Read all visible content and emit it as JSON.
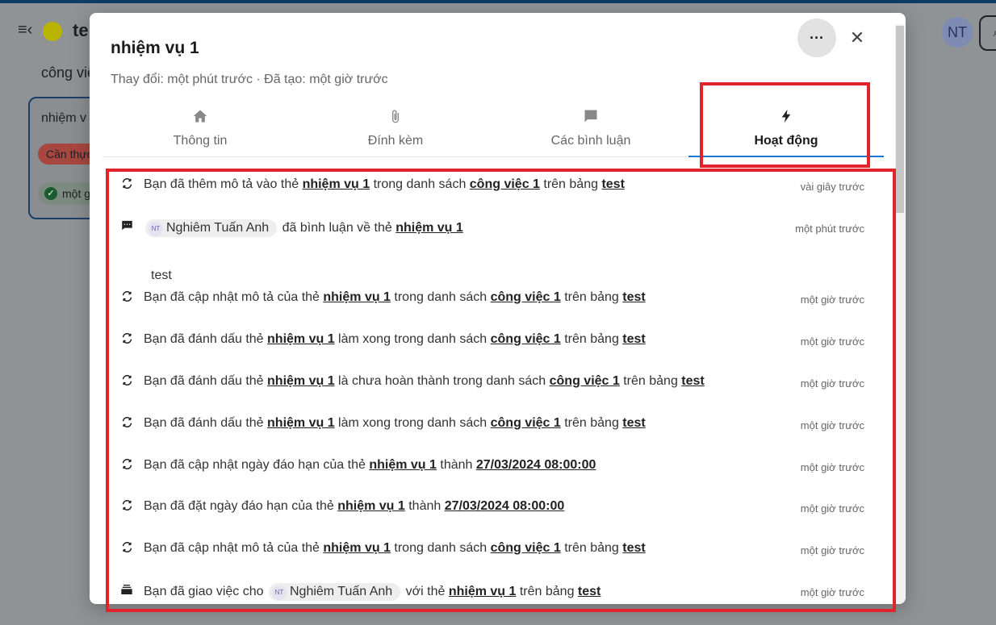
{
  "background": {
    "board_title": "te",
    "avatar_initials": "NT",
    "list_title": "công việ",
    "card_title": "nhiệm v",
    "card_label": "Cần thực",
    "card_due": "một g"
  },
  "modal": {
    "title": "nhiệm vụ 1",
    "subtitle": "Thay đổi: một phút trước · Đã tạo: một giờ trước",
    "more_label": "···",
    "close_label": "✕",
    "tabs": [
      {
        "label": "Thông tin",
        "icon": "home-icon"
      },
      {
        "label": "Đính kèm",
        "icon": "paperclip-icon"
      },
      {
        "label": "Các bình luận",
        "icon": "comment-icon"
      },
      {
        "label": "Hoạt động",
        "icon": "lightning-icon"
      }
    ],
    "activities": [
      {
        "icon": "refresh-icon",
        "time": "vài giây trước",
        "parts": [
          "Bạn đã thêm mô tả vào thẻ ",
          "nhiệm vụ 1",
          " trong danh sách ",
          "công việc 1",
          " trên bảng ",
          "test"
        ]
      },
      {
        "icon": "comment-icon",
        "time": "một phút trước",
        "user_initials": "NT",
        "user": "Nghiêm Tuấn Anh",
        "parts": [
          " đã bình luận về thẻ ",
          "nhiệm vụ 1"
        ],
        "comment": "test"
      },
      {
        "icon": "refresh-icon",
        "time": "một giờ trước",
        "parts": [
          "Bạn đã cập nhật mô tả của thẻ ",
          "nhiệm vụ 1",
          " trong danh sách ",
          "công việc 1",
          " trên bảng ",
          "test"
        ]
      },
      {
        "icon": "refresh-icon",
        "time": "một giờ trước",
        "parts": [
          "Bạn đã đánh dấu thẻ ",
          "nhiệm vụ 1",
          " làm xong trong danh sách ",
          "công việc 1",
          " trên bảng ",
          "test"
        ]
      },
      {
        "icon": "refresh-icon",
        "time": "một giờ trước",
        "parts": [
          "Bạn đã đánh dấu thẻ ",
          "nhiệm vụ 1",
          " là chưa hoàn thành trong danh sách ",
          "công việc 1",
          " trên bảng ",
          "test"
        ]
      },
      {
        "icon": "refresh-icon",
        "time": "một giờ trước",
        "parts": [
          "Bạn đã đánh dấu thẻ ",
          "nhiệm vụ 1",
          " làm xong trong danh sách ",
          "công việc 1",
          " trên bảng ",
          "test"
        ]
      },
      {
        "icon": "refresh-icon",
        "time": "một giờ trước",
        "parts": [
          "Bạn đã cập nhật ngày đáo hạn của thẻ ",
          "nhiệm vụ 1",
          " thành ",
          "27/03/2024 08:00:00"
        ]
      },
      {
        "icon": "refresh-icon",
        "time": "một giờ trước",
        "parts": [
          "Bạn đã đặt ngày đáo hạn của thẻ ",
          "nhiệm vụ 1",
          " thành ",
          "27/03/2024 08:00:00"
        ]
      },
      {
        "icon": "refresh-icon",
        "time": "một giờ trước",
        "parts": [
          "Bạn đã cập nhật mô tả của thẻ ",
          "nhiệm vụ 1",
          " trong danh sách ",
          "công việc 1",
          " trên bảng ",
          "test"
        ]
      },
      {
        "icon": "inbox-icon",
        "time": "một giờ trước",
        "user_initials": "NT",
        "user": "Nghiêm Tuấn Anh",
        "prefix": "Bạn đã giao việc cho ",
        "parts": [
          " với thẻ ",
          "nhiệm vụ 1",
          " trên bảng ",
          "test"
        ]
      }
    ]
  },
  "colors": {
    "highlight": "#e0232c",
    "active_tab_underline": "#1976d2"
  }
}
